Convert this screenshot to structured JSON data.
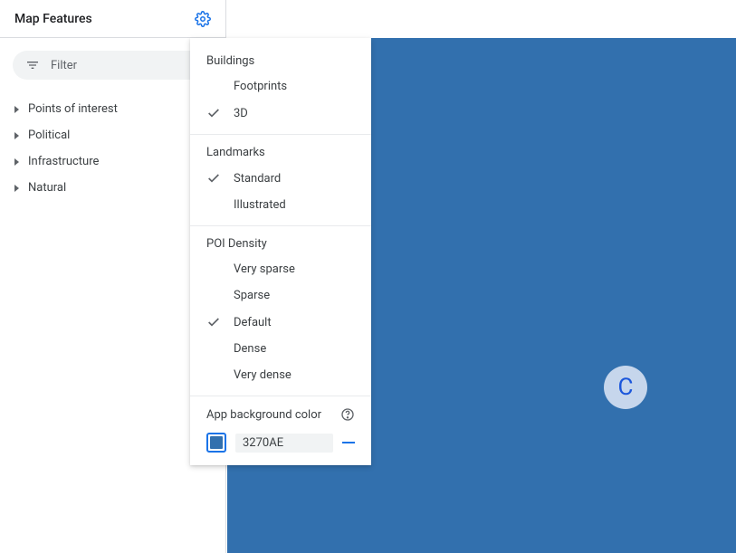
{
  "sidebar": {
    "title": "Map Features",
    "filter_placeholder": "Filter",
    "items": [
      {
        "label": "Points of interest"
      },
      {
        "label": "Political"
      },
      {
        "label": "Infrastructure"
      },
      {
        "label": "Natural"
      }
    ]
  },
  "settings": {
    "groups": [
      {
        "label": "Buildings",
        "options": [
          {
            "label": "Footprints",
            "checked": false
          },
          {
            "label": "3D",
            "checked": true
          }
        ]
      },
      {
        "label": "Landmarks",
        "options": [
          {
            "label": "Standard",
            "checked": true
          },
          {
            "label": "Illustrated",
            "checked": false
          }
        ]
      },
      {
        "label": "POI Density",
        "options": [
          {
            "label": "Very sparse",
            "checked": false
          },
          {
            "label": "Sparse",
            "checked": false
          },
          {
            "label": "Default",
            "checked": true
          },
          {
            "label": "Dense",
            "checked": false
          },
          {
            "label": "Very dense",
            "checked": false
          }
        ]
      }
    ],
    "bg_label": "App background color",
    "bg_value": "3270AE",
    "bg_hex": "#3270ae"
  },
  "compass": {
    "letter": "C"
  }
}
